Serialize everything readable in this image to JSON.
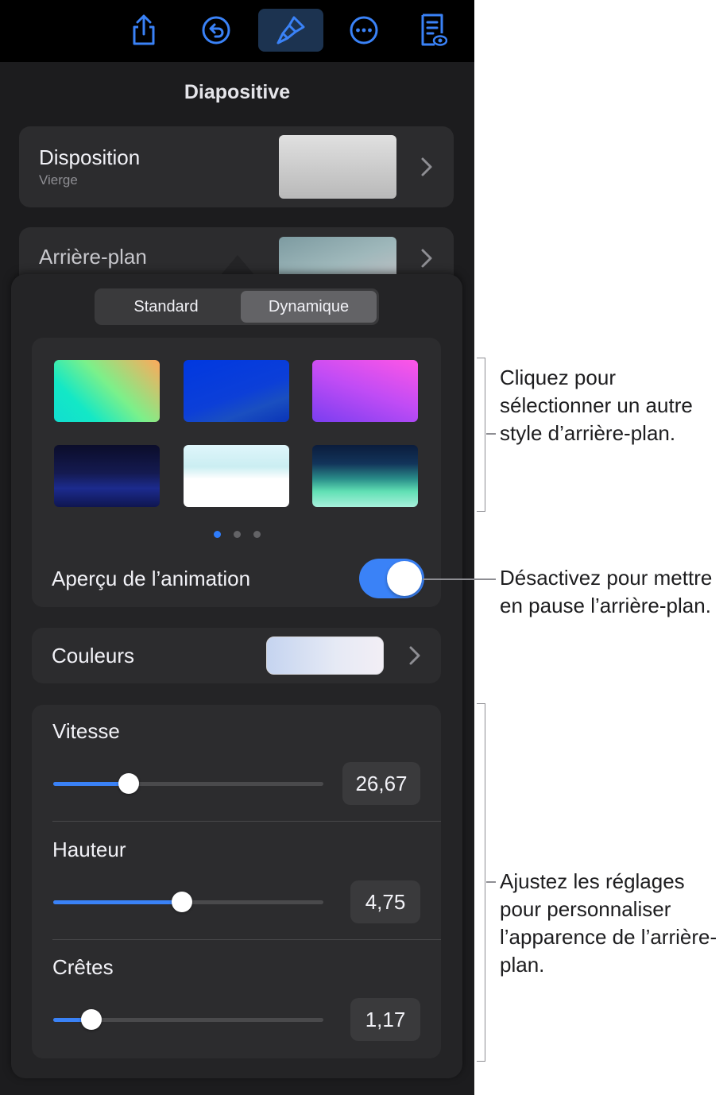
{
  "panel": {
    "title": "Diapositive",
    "layout_row": {
      "label": "Disposition",
      "sublabel": "Vierge"
    },
    "background_row": {
      "label": "Arrière-plan"
    }
  },
  "toolbar": {
    "icons": [
      "share-icon",
      "undo-icon",
      "format-brush-icon",
      "more-icon",
      "presenter-notes-icon"
    ],
    "active": "format-brush-icon",
    "accent": "#3a82f7"
  },
  "popover": {
    "segments": [
      "Standard",
      "Dynamique"
    ],
    "selected_segment": "Dynamique",
    "page_dots": 3,
    "current_page": 1,
    "animation_preview": {
      "label": "Aperçu de l’animation",
      "on": true
    },
    "colors_row": {
      "label": "Couleurs"
    },
    "sliders": [
      {
        "label": "Vitesse",
        "value": "26,67",
        "fraction": 0.28
      },
      {
        "label": "Hauteur",
        "value": "4,75",
        "fraction": 0.475
      },
      {
        "label": "Crêtes",
        "value": "1,17",
        "fraction": 0.14
      }
    ]
  },
  "callouts": [
    "Cliquez pour sélectionner un autre style d’arrière-plan.",
    "Désactivez pour mettre en pause l’arrière-plan.",
    "Ajustez les réglages pour personnaliser l’apparence de l’arrière-plan."
  ]
}
